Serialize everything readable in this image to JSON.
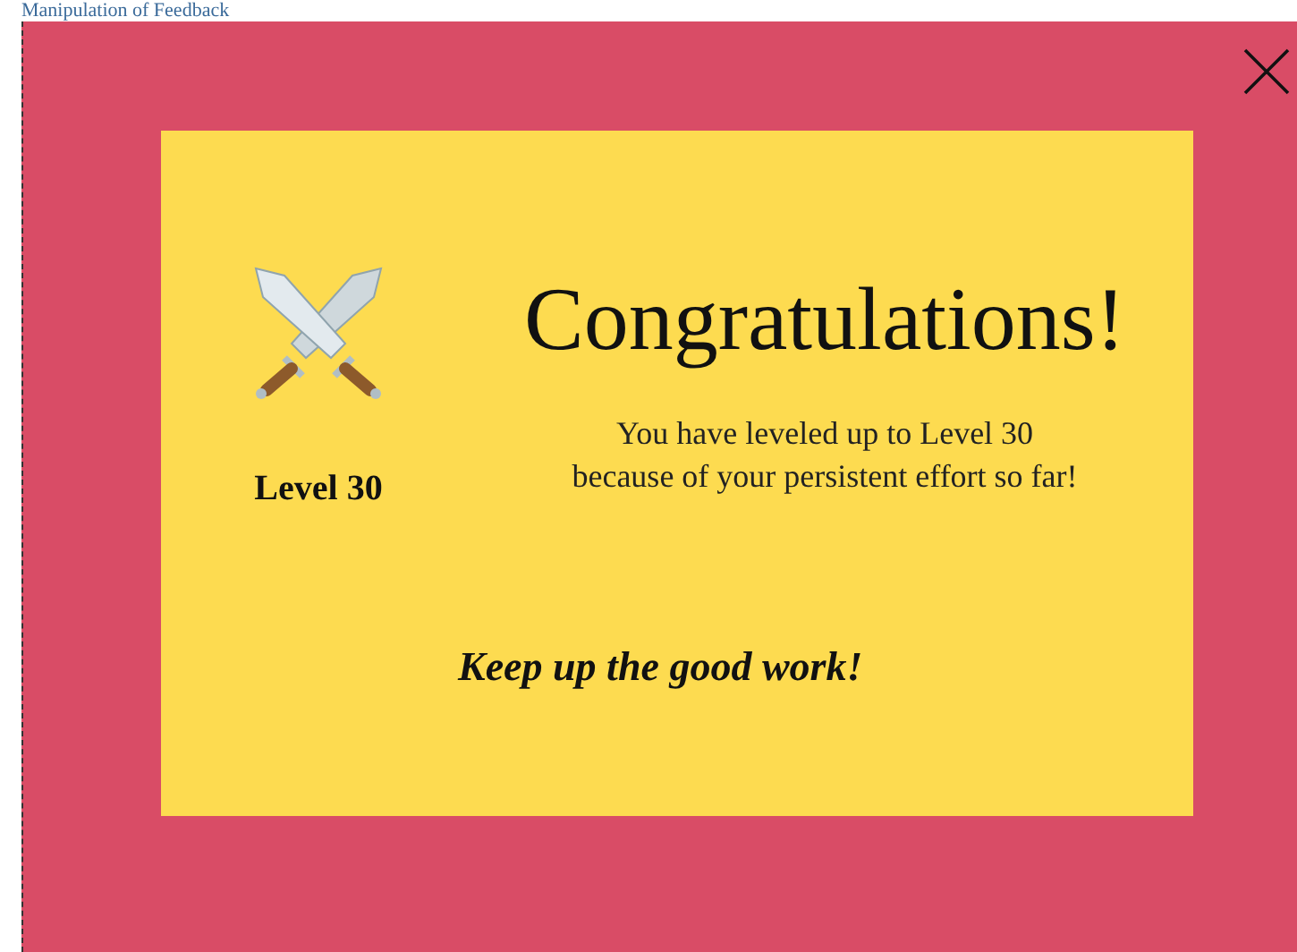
{
  "page_title": "Manipulation of Feedback",
  "dialog": {
    "level_label": "Level 30",
    "heading": "Congratulations!",
    "message_lines": [
      "You have leveled up to Level 30",
      "because of your persistent effort so far!"
    ],
    "encouragement": "Keep up the good work!"
  }
}
